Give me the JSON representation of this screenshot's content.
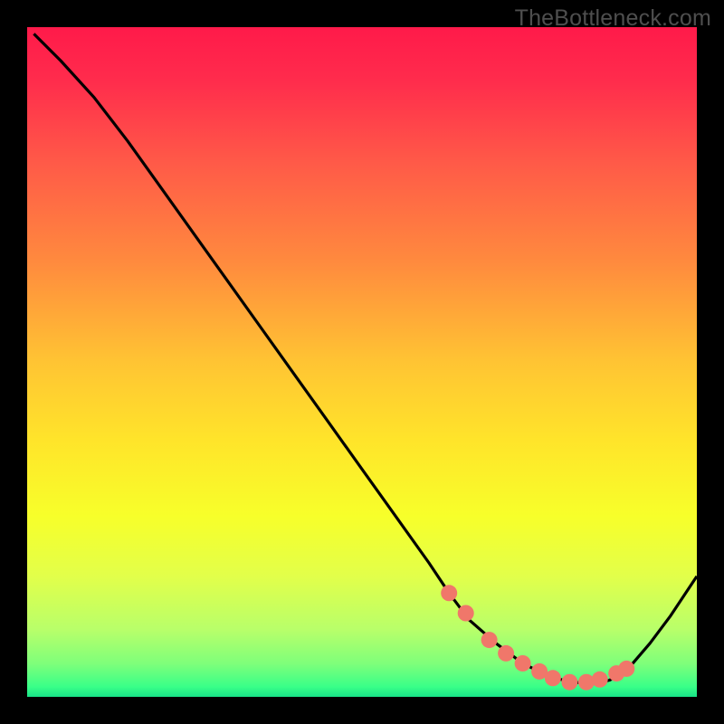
{
  "watermark": "TheBottleneck.com",
  "chart_data": {
    "type": "line",
    "title": "",
    "xlabel": "",
    "ylabel": "",
    "xlim": [
      0,
      100
    ],
    "ylim": [
      0,
      100
    ],
    "curve": {
      "x": [
        1,
        5,
        10,
        15,
        20,
        25,
        30,
        35,
        40,
        45,
        50,
        55,
        60,
        63,
        66,
        70,
        74,
        77,
        80,
        83,
        85,
        87,
        90,
        93,
        96,
        100
      ],
      "y": [
        99,
        95,
        89.5,
        83,
        76,
        69,
        62,
        55,
        48,
        41,
        34,
        27,
        20,
        15.5,
        11.5,
        8,
        5,
        3.5,
        2.5,
        2,
        2,
        2.5,
        4.5,
        8,
        12,
        18
      ]
    },
    "markers": {
      "x": [
        63,
        65.5,
        69,
        71.5,
        74,
        76.5,
        78.5,
        81,
        83.5,
        85.5,
        88,
        89.5
      ],
      "y": [
        15.5,
        12.5,
        8.5,
        6.5,
        5,
        3.8,
        2.8,
        2.2,
        2.2,
        2.6,
        3.5,
        4.2
      ]
    },
    "marker_color": "#f0776a",
    "curve_color": "#000000",
    "gradient_stops": [
      {
        "offset": 0,
        "color": "#ff1a4a"
      },
      {
        "offset": 0.08,
        "color": "#ff2c4c"
      },
      {
        "offset": 0.2,
        "color": "#ff5948"
      },
      {
        "offset": 0.35,
        "color": "#ff8a3e"
      },
      {
        "offset": 0.5,
        "color": "#ffc433"
      },
      {
        "offset": 0.62,
        "color": "#ffe52a"
      },
      {
        "offset": 0.73,
        "color": "#f7ff2a"
      },
      {
        "offset": 0.82,
        "color": "#e2ff4a"
      },
      {
        "offset": 0.9,
        "color": "#b8ff6a"
      },
      {
        "offset": 0.95,
        "color": "#7fff7a"
      },
      {
        "offset": 0.985,
        "color": "#39ff88"
      },
      {
        "offset": 1.0,
        "color": "#18e388"
      }
    ]
  }
}
